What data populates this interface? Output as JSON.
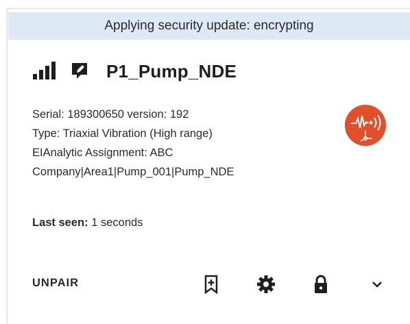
{
  "banner": {
    "text": "Applying security update: encrypting"
  },
  "device": {
    "name": "P1_Pump_NDE",
    "serial_line": "Serial: 189300650 version: 192",
    "type_line": "Type: Triaxial Vibration (High range)",
    "assignment_line1": "EIAnalytic Assignment: ABC",
    "assignment_line2": "Company|Area1|Pump_001|Pump_NDE",
    "badge_color": "#e2502b",
    "badge_icon": "triaxial-vibration-icon"
  },
  "status": {
    "last_seen_label": "Last seen:",
    "last_seen_value": "1 seconds"
  },
  "actions": {
    "unpair_label": "UNPAIR",
    "icons": [
      "bookmark-add-icon",
      "gear-icon",
      "lock-icon",
      "chevron-down-icon"
    ]
  }
}
